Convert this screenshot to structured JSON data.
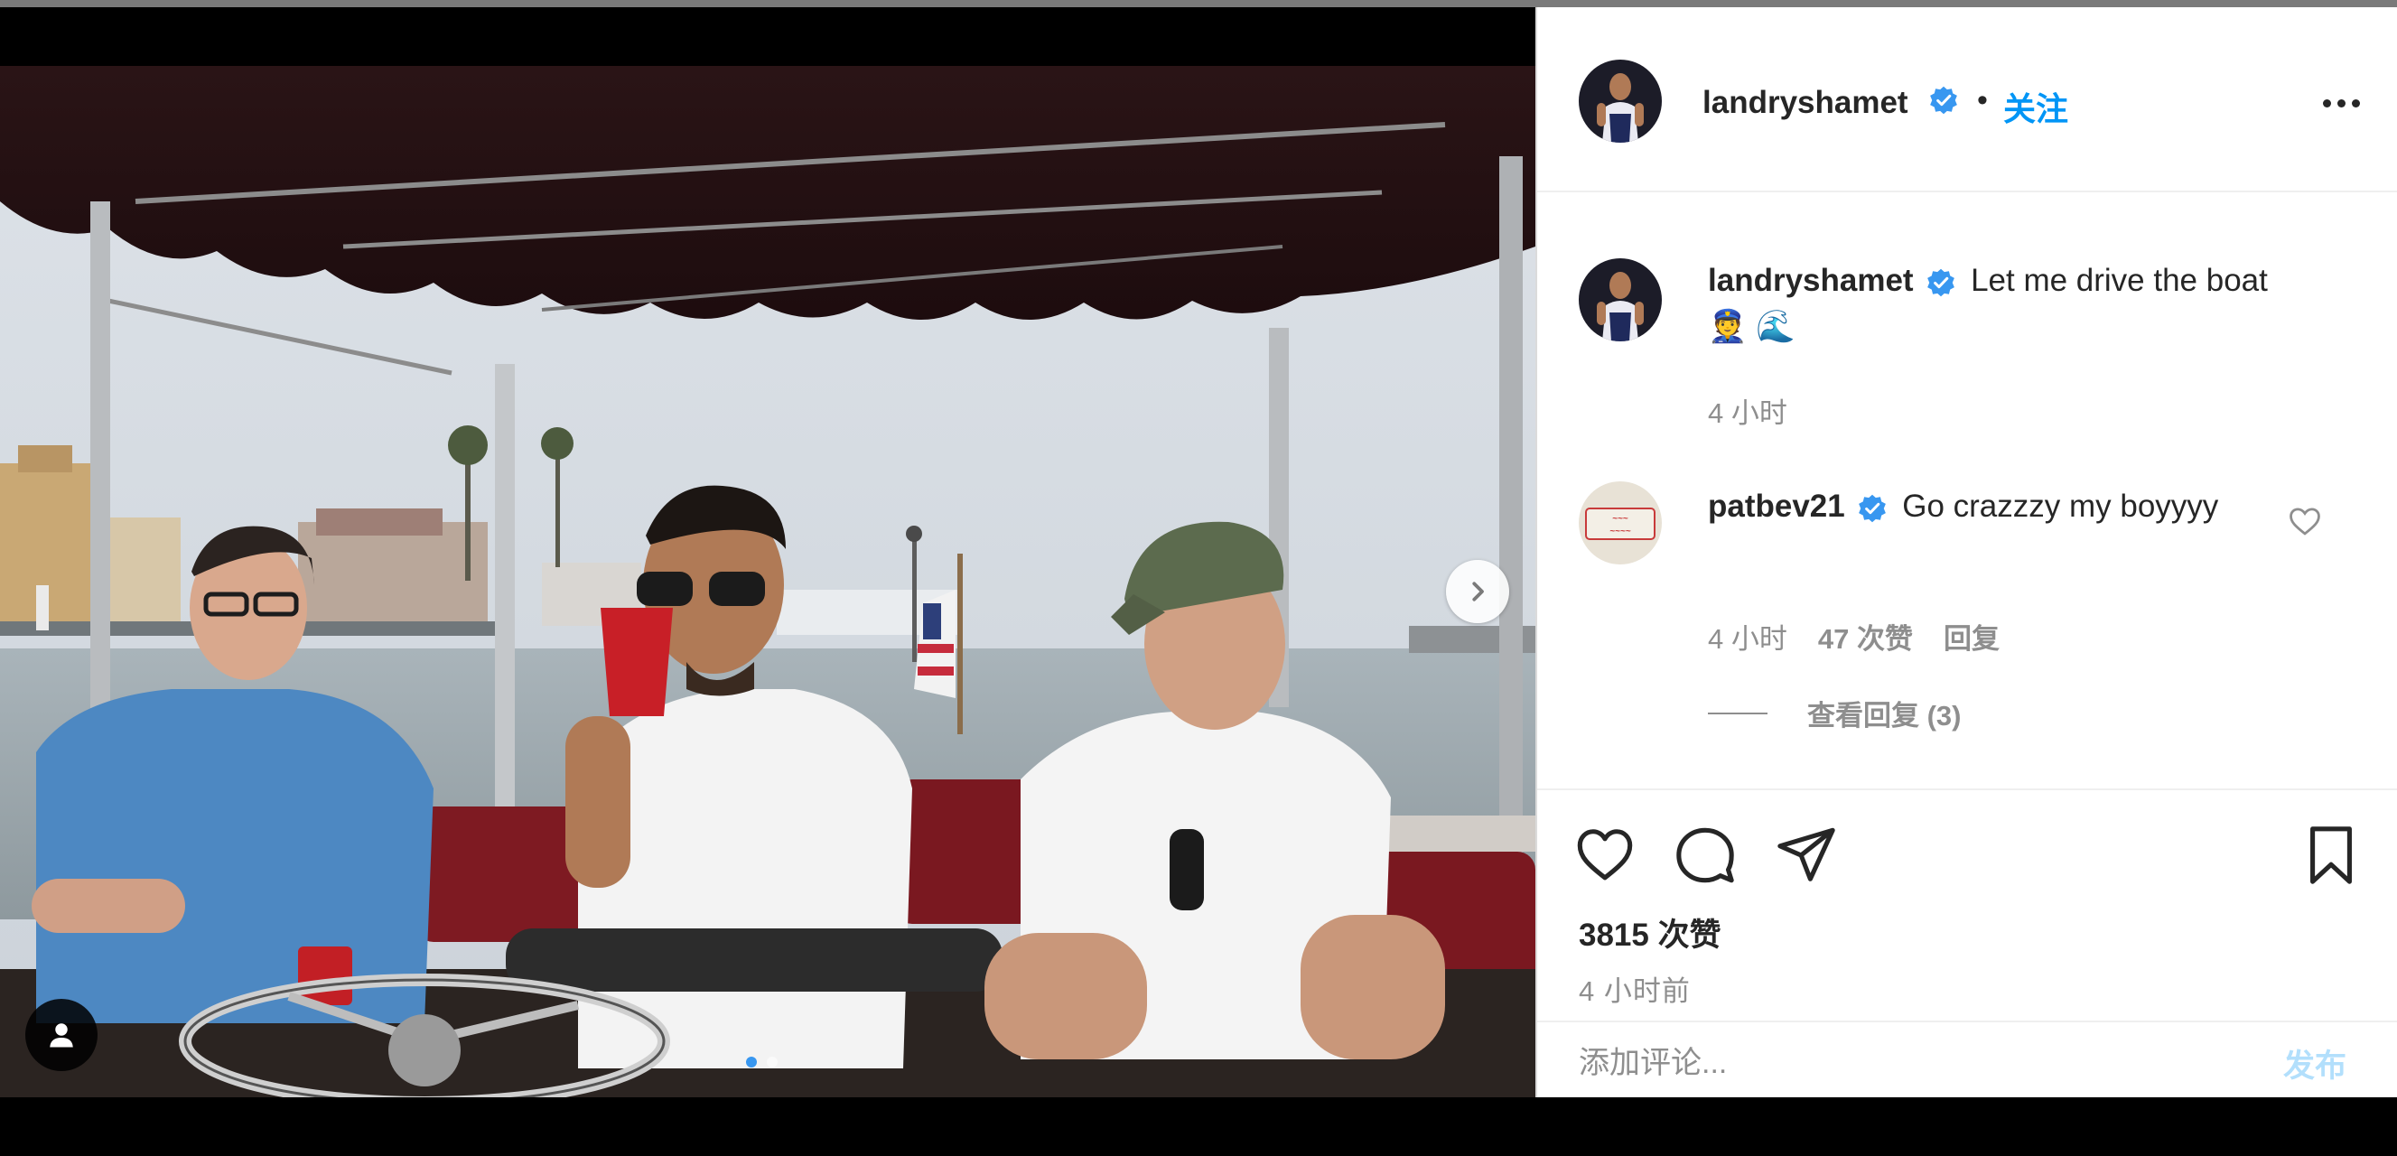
{
  "post": {
    "author": "landryshamet",
    "verified": true,
    "follow_label": "关注",
    "separator": "•",
    "image_alt": "Three men sitting on a canopied boat on the water",
    "carousel": {
      "slides": 2,
      "active_index": 0
    },
    "more_icon": "more-horizontal-icon"
  },
  "caption": {
    "username": "landryshamet",
    "text": "Let me drive the boat",
    "emoji_1": "👮",
    "emoji_2": "🌊",
    "time": "4 小时"
  },
  "comments": [
    {
      "username": "patbev21",
      "verified": true,
      "text": "Go crazzzy my boyyyy",
      "time": "4 小时",
      "likes": "47 次赞",
      "reply_label": "回复",
      "view_replies": "查看回复 (3)"
    }
  ],
  "actions": {
    "like_icon": "heart-icon",
    "comment_icon": "comment-icon",
    "share_icon": "paper-plane-icon",
    "save_icon": "bookmark-icon",
    "likes_count": "3815 次赞",
    "posted_time": "4 小时前"
  },
  "add_comment": {
    "placeholder": "添加评论...",
    "post_label": "发布"
  },
  "colors": {
    "accent": "#0095f6",
    "verified": "#3897f0",
    "secondary_text": "#8e8e8e",
    "post_disabled": "#b2dffc"
  }
}
